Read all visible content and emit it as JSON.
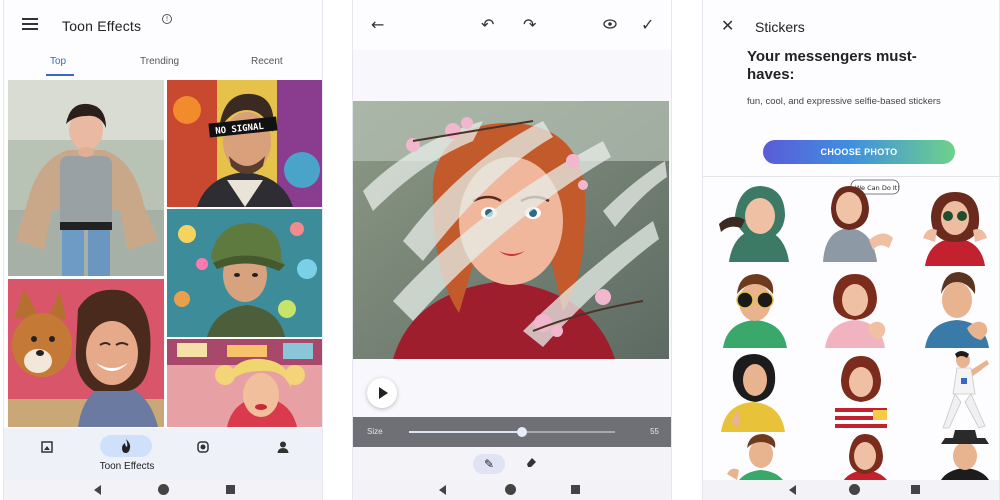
{
  "phone1": {
    "title": "Toon Effects",
    "tabs": [
      {
        "label": "Top",
        "active": true
      },
      {
        "label": "Trending",
        "active": false
      },
      {
        "label": "Recent",
        "active": false
      }
    ],
    "grid_images": [
      "girl-grey-tshirt-photo",
      "man-no-signal-cartoon",
      "man-green-cap-cartoon",
      "woman-with-dog-photo",
      "retro-woman-cartoon"
    ],
    "no_signal_caption": "NO SIGNAL",
    "bottom_nav": {
      "active_label": "Toon Effects",
      "items": [
        "gallery-icon",
        "flame-icon",
        "face-icon",
        "person-icon"
      ]
    }
  },
  "phone2": {
    "toolbar_icons": [
      "back-arrow-icon",
      "undo-icon",
      "redo-icon",
      "eye-icon",
      "check-icon"
    ],
    "size_label": "Size",
    "size_value": "55",
    "size_fraction": 0.55,
    "tools": [
      "brush-icon",
      "eraser-icon"
    ]
  },
  "phone3": {
    "title": "Stickers",
    "headline": "Your messengers must-haves:",
    "subtitle": "fun, cool, and expressive selfie-based stickers",
    "choose_button": "CHOOSE PHOTO",
    "speech_bubble": "We Can Do It!",
    "stickers": [
      "green-hoodie-girl",
      "we-can-do-it-woman",
      "sunglasses-woman",
      "sunglasses-man",
      "heart-hands-woman",
      "heart-hands-man",
      "yellow-jacket-woman",
      "striped-shirt-woman",
      "dancing-figure",
      "thumbs-up-boy",
      "red-top-woman",
      "hat-man"
    ]
  },
  "colors": {
    "accent_blue": "#3a66c8",
    "nav_pill": "#cfe0fb",
    "button_gradient_start": "#5b5bd8",
    "button_gradient_end": "#6ed18a"
  }
}
